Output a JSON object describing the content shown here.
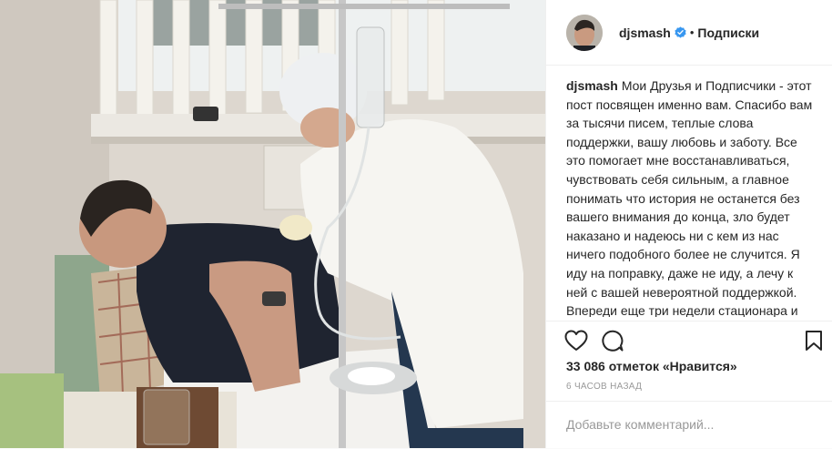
{
  "header": {
    "username": "djsmash",
    "separator": "•",
    "follow_label": "Подписки"
  },
  "caption": {
    "username": "djsmash",
    "text": "Мои Друзья и Подписчики - этот пост посвящен именно вам. Спасибо вам за тысячи писем, теплые слова поддержки, вашу любовь и заботу. Все это помогает мне восстанавливаться, чувствовать себя сильным, а главное понимать что история не останется без вашего внимания до конца, зло будет наказано и надеюсь ни с кем из нас ничего подобного более не случится. Я иду на поправку, даже не иду, а лечу к ней с вашей невероятной поддержкой. Впереди еще три недели стационара и питания через трубочку - чувствую супы, смузи и коктейли будут теперь надолго в"
  },
  "stats": {
    "likes": "33 086 отметок «Нравится»",
    "time_ago": "6 ЧАСОВ НАЗАД"
  },
  "comment": {
    "placeholder": "Добавьте комментарий..."
  },
  "icons": {
    "verified": "verified-badge-icon",
    "like": "heart-icon",
    "comment": "speech-bubble-icon",
    "save": "bookmark-icon"
  },
  "colors": {
    "verified_blue": "#3897f0",
    "text": "#262626",
    "muted": "#999999",
    "border": "#efefef"
  }
}
